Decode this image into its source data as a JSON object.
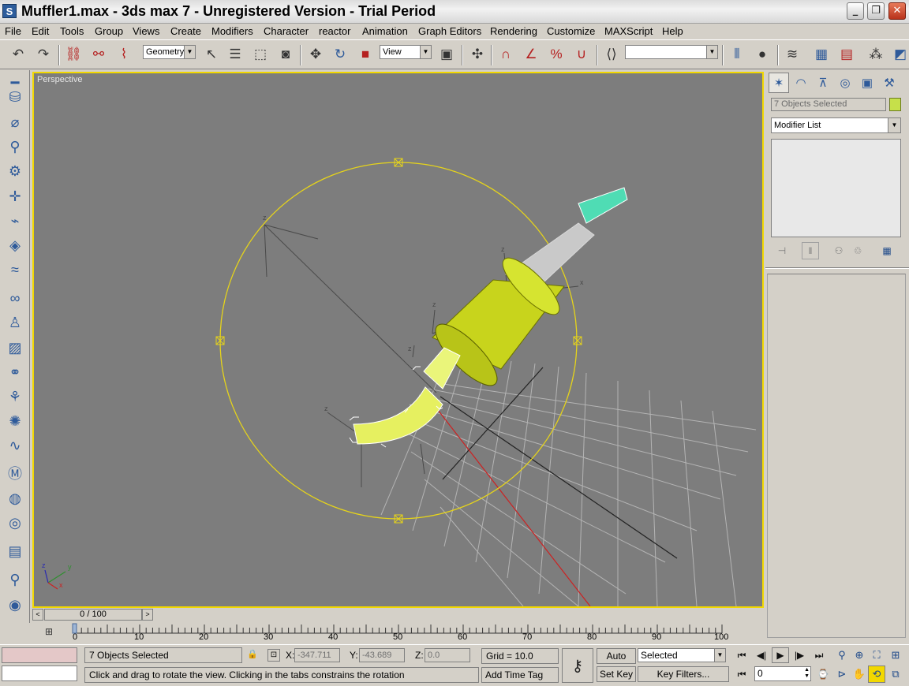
{
  "titlebar": {
    "app_icon": "S",
    "title": "Muffler1.max - 3ds max 7  - Unregistered Version - Trial Period",
    "minimize": "_",
    "restore": "❐",
    "close": "✕"
  },
  "menu": [
    "File",
    "Edit",
    "Tools",
    "Group",
    "Views",
    "Create",
    "Modifiers",
    "Character",
    "reactor",
    "Animation",
    "Graph Editors",
    "Rendering",
    "Customize",
    "MAXScript",
    "Help"
  ],
  "toolbar": {
    "selection_filter": "Geometry",
    "reference_coord": "View",
    "named_selection": ""
  },
  "viewport": {
    "label": "Perspective",
    "axis_x": "x",
    "axis_y": "y",
    "axis_z": "z"
  },
  "command_panel": {
    "object_name": "7 Objects Selected",
    "object_color": "#c6e04a",
    "modifier_list": "Modifier List"
  },
  "time_slider": {
    "position": "0 / 100",
    "prev": "<",
    "next": ">"
  },
  "trackbar": {
    "labels": [
      "0",
      "10",
      "20",
      "30",
      "40",
      "50",
      "60",
      "70",
      "80",
      "90",
      "100"
    ]
  },
  "status": {
    "selection": "7 Objects Selected",
    "x_label": "X:",
    "x_value": "-347.711",
    "y_label": "Y:",
    "y_value": "-43.689",
    "z_label": "Z:",
    "z_value": "0.0",
    "grid": "Grid = 10.0",
    "prompt": "Click and drag to rotate the view.  Clicking in the tabs constrains the rotation",
    "add_time_tag": "Add Time Tag",
    "auto_key": "Auto Key",
    "set_key": "Set Key",
    "key_mode": "Selected",
    "key_filters": "Key Filters...",
    "current_frame": "0"
  }
}
